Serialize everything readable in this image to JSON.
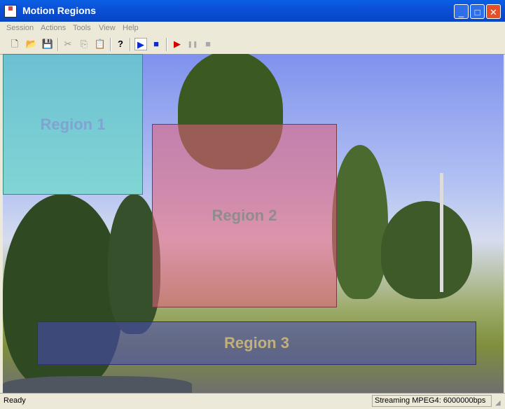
{
  "window": {
    "title": "Motion Regions"
  },
  "menu": [
    "Session",
    "Actions",
    "Tools",
    "View",
    "Help"
  ],
  "toolbar": {
    "new": "🗋",
    "open": "📂",
    "save": "💾",
    "cut": "✂",
    "copy": "⎘",
    "paste": "📋",
    "help": "?",
    "play": "▶",
    "stop": "■",
    "record": "▶",
    "pause": "❚❚",
    "stop_disabled": "■"
  },
  "regions": [
    {
      "label": "Region 1",
      "color": "#5fe0c0"
    },
    {
      "label": "Region 2",
      "color": "#e0607a"
    },
    {
      "label": "Region 3",
      "color": "#4848c0"
    }
  ],
  "status": {
    "left": "Ready",
    "right": "Streaming MPEG4: 6000000bps"
  }
}
